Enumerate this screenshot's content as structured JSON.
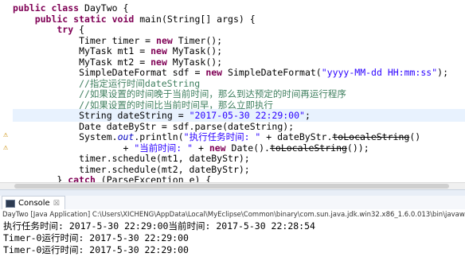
{
  "editor": {
    "lines": [
      {
        "id": "l1",
        "parts": [
          {
            "t": "public class ",
            "k": "kw"
          },
          {
            "t": "DayTwo {"
          }
        ]
      },
      {
        "id": "l2",
        "parts": [
          {
            "t": "    public static void ",
            "k": "kw"
          },
          {
            "t": "main(String[] args) {"
          }
        ]
      },
      {
        "id": "l3",
        "parts": [
          {
            "t": "        try ",
            "k": "kw"
          },
          {
            "t": "{"
          }
        ]
      },
      {
        "id": "l4",
        "parts": [
          {
            "t": "            Timer timer = "
          },
          {
            "t": "new ",
            "k": "kw"
          },
          {
            "t": "Timer();"
          }
        ]
      },
      {
        "id": "l5",
        "parts": [
          {
            "t": "            MyTask mt1 = "
          },
          {
            "t": "new ",
            "k": "kw"
          },
          {
            "t": "MyTask();"
          }
        ]
      },
      {
        "id": "l6",
        "parts": [
          {
            "t": "            MyTask mt2 = "
          },
          {
            "t": "new ",
            "k": "kw"
          },
          {
            "t": "MyTask();"
          }
        ]
      },
      {
        "id": "l7",
        "parts": [
          {
            "t": "            SimpleDateFormat sdf = "
          },
          {
            "t": "new ",
            "k": "kw"
          },
          {
            "t": "SimpleDateFormat("
          },
          {
            "t": "\"yyyy-MM-dd HH:mm:ss\"",
            "k": "str"
          },
          {
            "t": ");"
          }
        ]
      },
      {
        "id": "l8",
        "parts": [
          {
            "t": "            //指定运行时间dateString",
            "k": "cm"
          }
        ]
      },
      {
        "id": "l9",
        "parts": [
          {
            "t": "            //如果设置的时间晚于当前时间，那么到达预定的时间再运行程序",
            "k": "cm"
          }
        ]
      },
      {
        "id": "l10",
        "parts": [
          {
            "t": "            //如果设置的时间比当前时间早，那么立即执行",
            "k": "cm"
          }
        ]
      },
      {
        "id": "l11",
        "hl": true,
        "parts": [
          {
            "t": "            String dateString = "
          },
          {
            "t": "\"2017-05-30 22:29:00\"",
            "k": "str"
          },
          {
            "t": ";"
          }
        ]
      },
      {
        "id": "l12",
        "parts": [
          {
            "t": "            Date dateByStr = sdf.parse(dateString);"
          }
        ]
      },
      {
        "id": "l13",
        "parts": [
          {
            "t": "            System."
          },
          {
            "t": "out",
            "k": "fld"
          },
          {
            "t": ".println("
          },
          {
            "t": "\"执行任务时间: \"",
            "k": "str"
          },
          {
            "t": " + dateByStr."
          },
          {
            "t": "toLocaleString",
            "k": "dep"
          },
          {
            "t": "()"
          }
        ]
      },
      {
        "id": "l14",
        "parts": [
          {
            "t": "                    + "
          },
          {
            "t": "\"当前时间: \"",
            "k": "str"
          },
          {
            "t": " + "
          },
          {
            "t": "new ",
            "k": "kw"
          },
          {
            "t": "Date()."
          },
          {
            "t": "toLocaleString",
            "k": "dep"
          },
          {
            "t": "());"
          }
        ]
      },
      {
        "id": "l15",
        "parts": [
          {
            "t": "            timer.schedule(mt1, dateByStr);"
          }
        ]
      },
      {
        "id": "l16",
        "parts": [
          {
            "t": "            timer.schedule(mt2, dateByStr);"
          }
        ]
      },
      {
        "id": "l17",
        "parts": [
          {
            "t": "        } "
          },
          {
            "t": "catch ",
            "k": "kw"
          },
          {
            "t": "(ParseException e) {"
          }
        ]
      }
    ]
  },
  "console": {
    "tab_label": "Console",
    "close_glyph": "☒",
    "status": "DayTwo [Java Application] C:\\Users\\XICHENG\\AppData\\Local\\MyEclipse\\Common\\binary\\com.sun.java.jdk.win32.x86_1.6.0.013\\bin\\javaw.exe (",
    "output": [
      "执行任务时间: 2017-5-30 22:29:00当前时间: 2017-5-30 22:28:54",
      "Timer-0运行时间: 2017-5-30 22:29:00",
      "Timer-0运行时间: 2017-5-30 22:29:00"
    ]
  },
  "icons": {
    "warning_marker": "warning-icon",
    "console_icon": "console-icon",
    "close_icon": "close-icon"
  },
  "colors": {
    "keyword": "#7f0055",
    "string": "#2a00ff",
    "comment": "#3f7f5f",
    "field": "#0000c0"
  }
}
